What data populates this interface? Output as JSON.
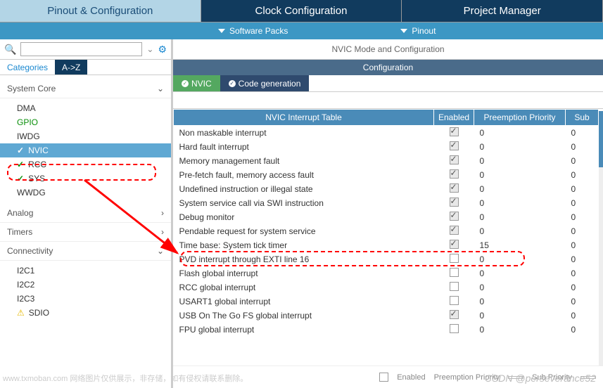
{
  "tabs": {
    "main": [
      {
        "label": "Pinout & Configuration",
        "state": "active"
      },
      {
        "label": "Clock Configuration",
        "state": "dark"
      },
      {
        "label": "Project Manager",
        "state": "dark"
      }
    ],
    "sub": [
      {
        "label": "Software Packs"
      },
      {
        "label": "Pinout"
      }
    ]
  },
  "sidebar": {
    "search_placeholder": "",
    "sort_tabs": {
      "cat": "Categories",
      "az": "A->Z"
    },
    "sections": [
      {
        "label": "System Core",
        "expanded": true,
        "items": [
          {
            "label": "DMA",
            "style": "normal"
          },
          {
            "label": "GPIO",
            "style": "green"
          },
          {
            "label": "IWDG",
            "style": "normal"
          },
          {
            "label": "NVIC",
            "style": "selected-check"
          },
          {
            "label": "RCC",
            "style": "check"
          },
          {
            "label": "SYS",
            "style": "check"
          },
          {
            "label": "WWDG",
            "style": "normal"
          }
        ]
      },
      {
        "label": "Analog",
        "expanded": false
      },
      {
        "label": "Timers",
        "expanded": false
      },
      {
        "label": "Connectivity",
        "expanded": true,
        "items": [
          {
            "label": "I2C1",
            "style": "normal"
          },
          {
            "label": "I2C2",
            "style": "normal"
          },
          {
            "label": "I2C3",
            "style": "normal"
          },
          {
            "label": "SDIO",
            "style": "warn"
          }
        ]
      }
    ]
  },
  "panel": {
    "title": "NVIC Mode and Configuration",
    "config_header": "Configuration",
    "inner_tabs": [
      {
        "label": "NVIC",
        "style": "active"
      },
      {
        "label": "Code generation",
        "style": "code"
      }
    ],
    "table": {
      "columns": [
        "NVIC Interrupt Table",
        "Enabled",
        "Preemption Priority",
        "Sub"
      ],
      "rows": [
        {
          "name": "Non maskable interrupt",
          "enabled": true,
          "disabled_chk": true,
          "preempt": "0",
          "sub": "0"
        },
        {
          "name": "Hard fault interrupt",
          "enabled": true,
          "disabled_chk": true,
          "preempt": "0",
          "sub": "0"
        },
        {
          "name": "Memory management fault",
          "enabled": true,
          "disabled_chk": true,
          "preempt": "0",
          "sub": "0"
        },
        {
          "name": "Pre-fetch fault, memory access fault",
          "enabled": true,
          "disabled_chk": true,
          "preempt": "0",
          "sub": "0"
        },
        {
          "name": "Undefined instruction or illegal state",
          "enabled": true,
          "disabled_chk": true,
          "preempt": "0",
          "sub": "0"
        },
        {
          "name": "System service call via SWI instruction",
          "enabled": true,
          "disabled_chk": true,
          "preempt": "0",
          "sub": "0"
        },
        {
          "name": "Debug monitor",
          "enabled": true,
          "disabled_chk": true,
          "preempt": "0",
          "sub": "0"
        },
        {
          "name": "Pendable request for system service",
          "enabled": true,
          "disabled_chk": true,
          "preempt": "0",
          "sub": "0"
        },
        {
          "name": "Time base: System tick timer",
          "enabled": true,
          "disabled_chk": true,
          "preempt": "15",
          "sub": "0"
        },
        {
          "name": "PVD interrupt through EXTI line 16",
          "enabled": false,
          "preempt": "0",
          "sub": "0"
        },
        {
          "name": "Flash global interrupt",
          "enabled": false,
          "preempt": "0",
          "sub": "0"
        },
        {
          "name": "RCC global interrupt",
          "enabled": false,
          "preempt": "0",
          "sub": "0"
        },
        {
          "name": "USART1 global interrupt",
          "enabled": false,
          "preempt": "0",
          "sub": "0"
        },
        {
          "name": "USB On The Go FS global interrupt",
          "enabled": true,
          "disabled_chk": true,
          "preempt": "0",
          "sub": "0"
        },
        {
          "name": "FPU global interrupt",
          "enabled": false,
          "preempt": "0",
          "sub": "0"
        }
      ]
    },
    "footer": {
      "enabled_label": "Enabled",
      "preempt_label": "Preemption Priority",
      "sub_label": "Sub Priority"
    }
  },
  "watermarks": {
    "left": "www.txmoban.com 网络图片仅供展示，非存储，如有侵权请联系删除。",
    "right": "CSDN @perseverance52"
  }
}
